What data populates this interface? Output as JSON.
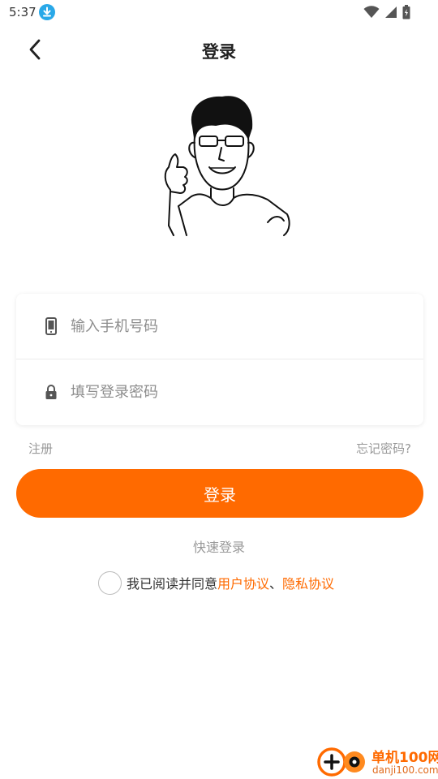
{
  "status_bar": {
    "time": "5:37"
  },
  "header": {
    "title": "登录"
  },
  "form": {
    "phone_placeholder": "输入手机号码",
    "password_placeholder": "填写登录密码"
  },
  "links": {
    "register": "注册",
    "forgot_password": "忘记密码?"
  },
  "login_button_label": "登录",
  "quick_login": "快速登录",
  "agreement": {
    "text": "我已阅读并同意",
    "user_agreement": "用户协议",
    "separator": "、",
    "privacy_policy": "隐私协议",
    "checked": false
  },
  "watermark": {
    "line1": "单机100网",
    "line2": "danji100.com"
  },
  "colors": {
    "accent": "#ff6a00",
    "muted_text": "#999999",
    "download_badge": "#29a8e8"
  },
  "icons": {
    "download": "download-icon",
    "wifi": "wifi-icon",
    "signal": "signal-icon",
    "battery": "battery-icon",
    "back": "chevron-left-icon",
    "phone": "phone-icon",
    "lock": "lock-icon"
  }
}
